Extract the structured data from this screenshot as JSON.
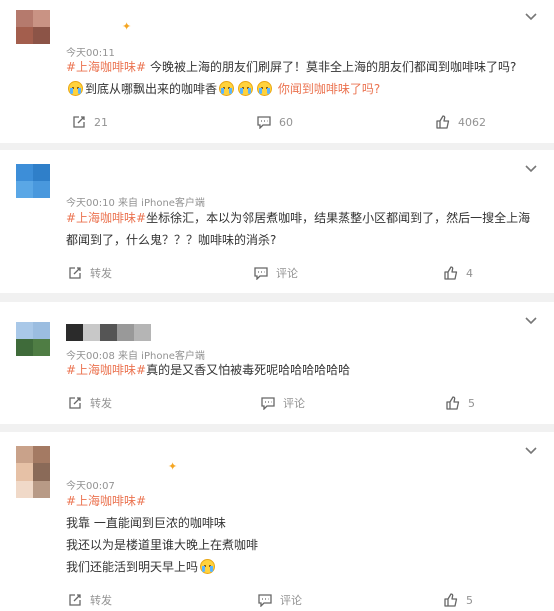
{
  "comments": [
    {
      "meta": "今天00:11",
      "paragraphs": [
        {
          "tag": "#上海咖啡味#",
          "text": " 今晚被上海的朋友们刷屏了！莫非全上海的朋友们都闻到咖啡味了吗?"
        },
        {
          "text": "到底从哪飘出来的咖啡香",
          "tail": "你闻到咖啡味了吗?"
        }
      ],
      "repost_label": "21",
      "comment_label": "60",
      "like_label": "4062"
    },
    {
      "meta": "今天00:10  来自 iPhone客户端",
      "paragraphs": [
        {
          "tag": "#上海咖啡味#",
          "text": "坐标徐汇，本以为邻居煮咖啡，结果蒸整小区都闻到了，然后一搜全上海"
        },
        {
          "text": "都闻到了，什么鬼？？？咖啡味的消杀?"
        }
      ],
      "repost_label": "转发",
      "comment_label": "评论",
      "like_label": "4"
    },
    {
      "meta": "今天00:08  来自 iPhone客户端",
      "paragraphs": [
        {
          "tag": "#上海咖啡味#",
          "text": "真的是又香又怕被毒死呢哈哈哈哈哈哈"
        }
      ],
      "repost_label": "转发",
      "comment_label": "评论",
      "like_label": "5"
    },
    {
      "meta": "今天00:07",
      "paragraphs": [
        {
          "tag": "#上海咖啡味#",
          "text": ""
        },
        {
          "text": "我靠 一直能闻到巨浓的咖啡味"
        },
        {
          "text": "我还以为是楼道里谁大晚上在煮咖啡"
        },
        {
          "text": "我们还能活到明天早上吗"
        }
      ],
      "repost_label": "转发",
      "comment_label": "评论",
      "like_label": "5"
    }
  ],
  "colors": {
    "tag": "#eb7350",
    "meta": "#939393",
    "text": "#333333",
    "background": "#f1f1f1"
  },
  "icons": {
    "repost": "repost-icon",
    "comment": "comment-icon",
    "like": "thumbs-up-icon",
    "menu": "chevron-down-icon",
    "emoji": "crying-face-emoji"
  }
}
